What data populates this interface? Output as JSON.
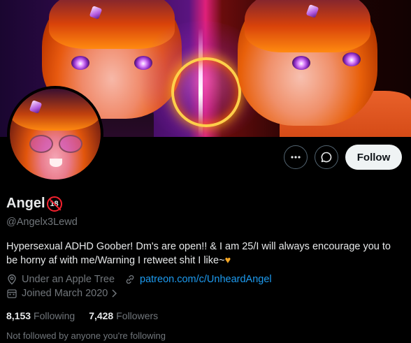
{
  "profile": {
    "display_name": "Angel",
    "age_badge": "18",
    "handle": "@Angelx3Lewd",
    "bio": "Hypersexual ADHD Goober! Dm's are open!! & I am 25/I will always encourage you to be horny af with me/Warning I retweet shit I like~",
    "bio_emoji": "♥",
    "location": "Under an Apple Tree",
    "website": "patreon.com/c/UnheardAngel",
    "joined": "Joined March 2020",
    "following_count": "8,153",
    "following_label": "Following",
    "followers_count": "7,428",
    "followers_label": "Followers",
    "not_followed_text": "Not followed by anyone you're following"
  },
  "actions": {
    "follow_label": "Follow",
    "more_icon": "more-icon",
    "message_icon": "message-icon"
  },
  "colors": {
    "link": "#1d9bf0",
    "muted": "#71767b",
    "follow_bg": "#eff3f4"
  }
}
